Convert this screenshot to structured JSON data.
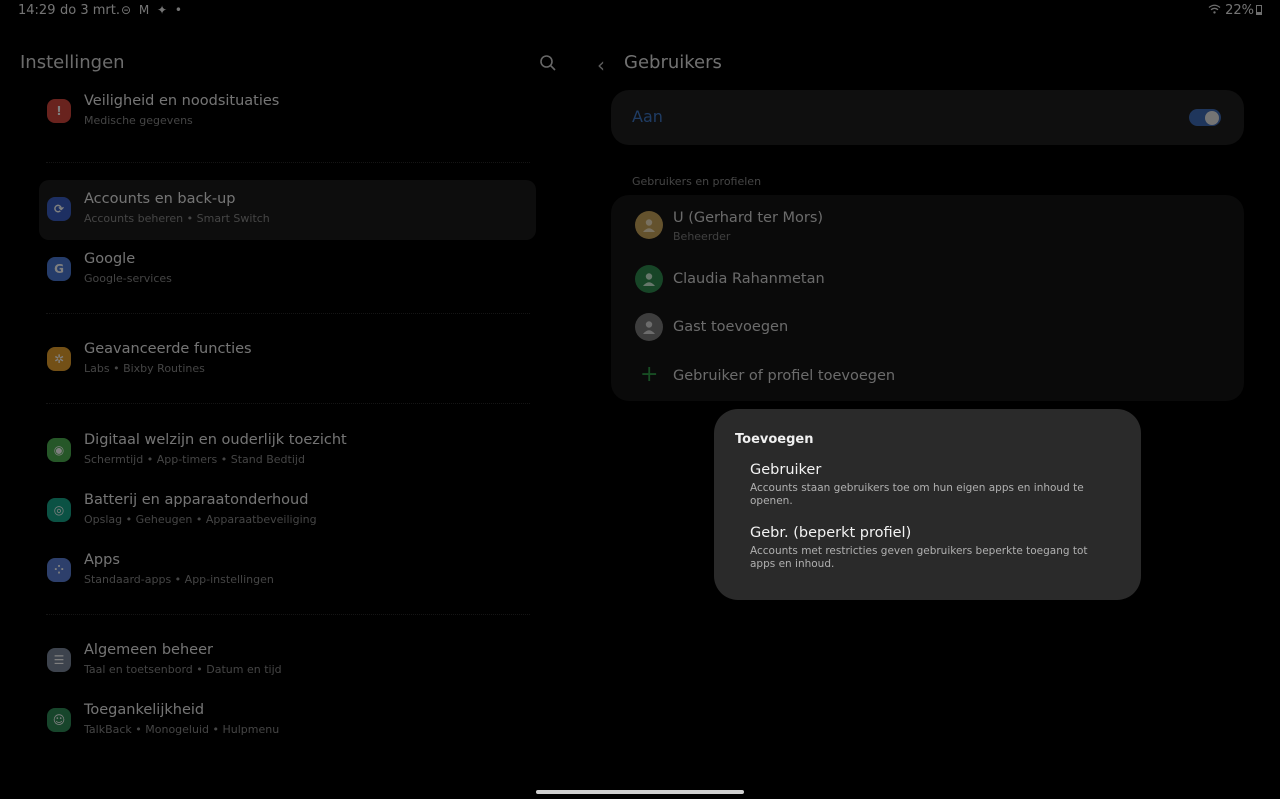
{
  "status_bar": {
    "time": "14:29",
    "date": "do 3 mrt.",
    "notification_icons": "⊝ M ✦ •",
    "battery": "22%"
  },
  "left_panel": {
    "title": "Instellingen",
    "items": [
      {
        "title": "Veiligheid en noodsituaties",
        "subtitle": "Medische gegevens",
        "icon": "alert-icon",
        "color": "#d3463d",
        "glyph": "!"
      },
      {
        "title": "Accounts en back-up",
        "subtitle": "Accounts beheren  •  Smart Switch",
        "icon": "sync-icon",
        "color": "#3b5fc4",
        "glyph": "⟳"
      },
      {
        "title": "Google",
        "subtitle": "Google-services",
        "icon": "google-icon",
        "color": "#4a78d4",
        "glyph": "G"
      },
      {
        "title": "Geavanceerde functies",
        "subtitle": "Labs  •  Bixby Routines",
        "icon": "gear-plus-icon",
        "color": "#e6a02d",
        "glyph": "✲"
      },
      {
        "title": "Digitaal welzijn en ouderlijk toezicht",
        "subtitle": "Schermtijd  •  App-timers  •  Stand Bedtijd",
        "icon": "wellbeing-icon",
        "color": "#4caf50",
        "glyph": "◉"
      },
      {
        "title": "Batterij en apparaatonderhoud",
        "subtitle": "Opslag  •  Geheugen  •  Apparaatbeveiliging",
        "icon": "device-care-icon",
        "color": "#17a589",
        "glyph": "◎"
      },
      {
        "title": "Apps",
        "subtitle": "Standaard-apps  •  App-instellingen",
        "icon": "apps-icon",
        "color": "#5a7fd6",
        "glyph": "⁘"
      },
      {
        "title": "Algemeen beheer",
        "subtitle": "Taal en toetsenbord  •  Datum en tijd",
        "icon": "sliders-icon",
        "color": "#7a869a",
        "glyph": "☰"
      },
      {
        "title": "Toegankelijkheid",
        "subtitle": "TalkBack  •  Monogeluid  •  Hulpmenu",
        "icon": "accessibility-icon",
        "color": "#2e8b57",
        "glyph": "☺"
      }
    ]
  },
  "right_panel": {
    "back_glyph": "‹",
    "title": "Gebruikers",
    "toggle_label": "Aan",
    "section_header": "Gebruikers en profielen",
    "users": [
      {
        "name": "U (Gerhard ter Mors)",
        "subtitle": "Beheerder",
        "avatar_color": "#c9a45a"
      },
      {
        "name": "Claudia Rahanmetan",
        "subtitle": "",
        "avatar_color": "#2e8b4e"
      },
      {
        "name": "Gast toevoegen",
        "subtitle": "",
        "avatar_color": "#7a7a7a"
      }
    ],
    "add_label": "Gebruiker of profiel toevoegen",
    "add_glyph": "+"
  },
  "dialog": {
    "title": "Toevoegen",
    "options": [
      {
        "title": "Gebruiker",
        "description": "Accounts staan gebruikers toe om hun eigen apps en inhoud te openen."
      },
      {
        "title": "Gebr. (beperkt profiel)",
        "description": "Accounts met restricties geven gebruikers beperkte toegang tot apps en inhoud."
      }
    ]
  }
}
